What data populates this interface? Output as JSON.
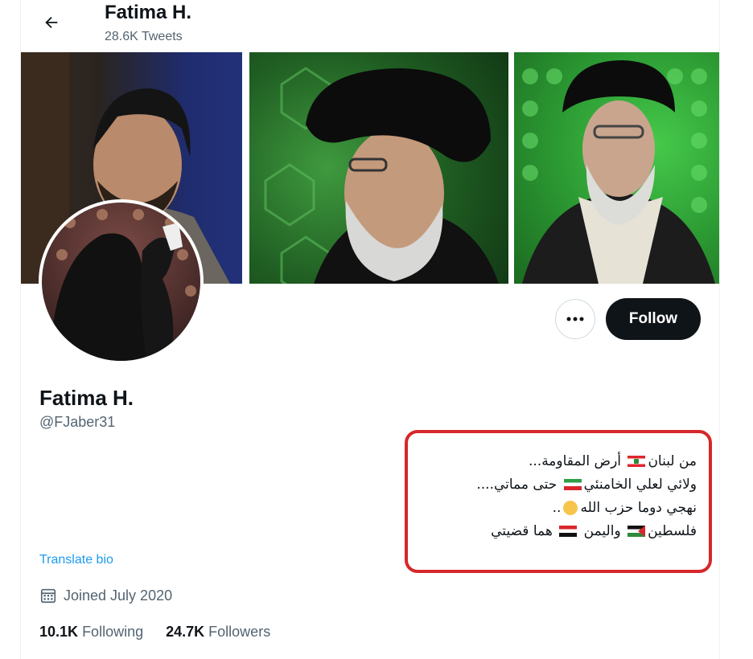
{
  "header": {
    "name": "Fatima H.",
    "tweet_count": "28.6K Tweets",
    "back_icon": "arrow-left-icon"
  },
  "profile": {
    "name": "Fatima H.",
    "handle": "@FJaber31",
    "follow_label": "Follow",
    "more_icon": "ellipsis-icon",
    "bio_lines": [
      "من لبنان",
      "أرض المقاومة...",
      "ولائي لعلي الخامنئي",
      "حتى مماتي....",
      "نهجي دوما حزب الله",
      "..",
      "فلسطين",
      "واليمن",
      "هما قضيتي"
    ],
    "translate_label": "Translate bio",
    "joined": "Joined July 2020",
    "following_count": "10.1K",
    "following_label": "Following",
    "followers_count": "24.7K",
    "followers_label": "Followers"
  },
  "colors": {
    "follow_bg": "#0f1419",
    "link": "#1d9bf0",
    "highlight_border": "#d6282b",
    "secondary_text": "#536471"
  }
}
